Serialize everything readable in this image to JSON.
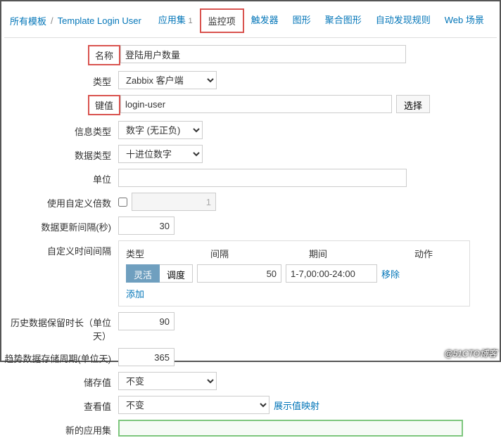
{
  "breadcrumb": {
    "all_templates": "所有模板",
    "template_name": "Template Login User"
  },
  "tabs": {
    "apps": {
      "label": "应用集",
      "count": "1"
    },
    "items": {
      "label": "监控项"
    },
    "triggers": {
      "label": "触发器"
    },
    "graphs": {
      "label": "图形"
    },
    "screens": {
      "label": "聚合图形"
    },
    "discovery": {
      "label": "自动发现规则"
    },
    "web": {
      "label": "Web 场景"
    }
  },
  "form": {
    "name_label": "名称",
    "name_value": "登陆用户数量",
    "type_label": "类型",
    "type_value": "Zabbix 客户端",
    "key_label": "键值",
    "key_value": "login-user",
    "key_select": "选择",
    "info_label": "信息类型",
    "info_value": "数字 (无正负)",
    "data_label": "数据类型",
    "data_value": "十进位数字",
    "unit_label": "单位",
    "unit_value": "",
    "multiplier_label": "使用自定义倍数",
    "multiplier_value": "1",
    "update_label": "数据更新间隔(秒)",
    "update_value": "30",
    "custom_interval_label": "自定义时间间隔",
    "interval": {
      "h_type": "类型",
      "h_interval": "间隔",
      "h_period": "期间",
      "h_action": "动作",
      "flexible": "灵活",
      "scheduling": "调度",
      "interval_value": "50",
      "period_value": "1-7,00:00-24:00",
      "remove": "移除",
      "add": "添加"
    },
    "history_label": "历史数据保留时长（单位天）",
    "history_value": "90",
    "trends_label": "趋势数据存储周期(单位天)",
    "trends_value": "365",
    "store_label": "储存值",
    "store_value": "不变",
    "view_label": "查看值",
    "view_value": "不变",
    "view_mapping": "展示值映射",
    "newapp_label": "新的应用集"
  },
  "watermark": "@51CTO博客"
}
